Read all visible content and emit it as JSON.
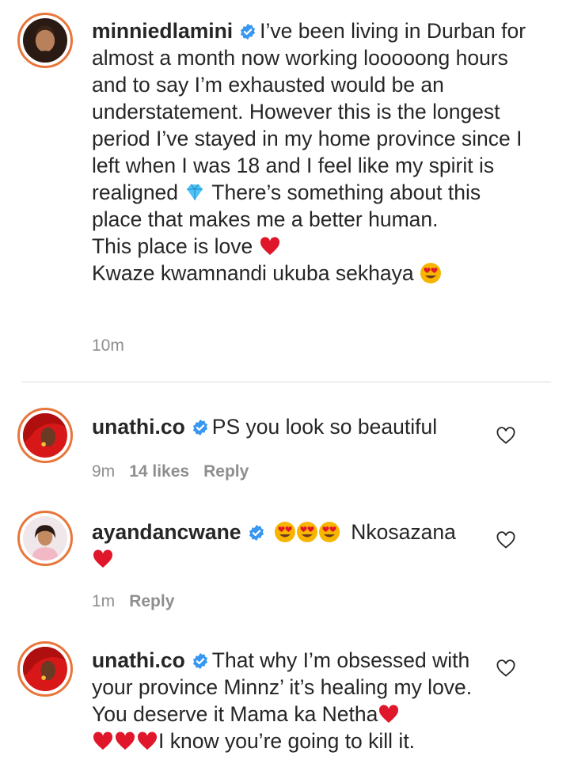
{
  "post": {
    "username": "minniedlamini",
    "caption_1": "I’ve been living in Durban for almost a month now working looooong hours and to say I’m exhausted would be an understatement. However this is the longest period I’ve stayed in my home province since I left when I was 18 and I feel like my spirit is realigned",
    "caption_2": "There’s something about this place that makes me a better human.",
    "caption_3": "This place is love",
    "caption_4": "Kwaze kwamnandi ukuba sekhaya",
    "time": "10m"
  },
  "comments": [
    {
      "username": "unathi.co",
      "text": "PS you look so beautiful",
      "time": "9m",
      "likes": "14 likes",
      "reply": "Reply"
    },
    {
      "username": "ayandancwane",
      "text": "Nkosazana",
      "time": "1m",
      "reply": "Reply"
    },
    {
      "username": "unathi.co",
      "text_1": "That why I’m obsessed with your province Minnz’ it’s healing my love. You deserve it Mama ka Netha",
      "text_2": "I know you’re going to kill it."
    }
  ],
  "colors": {
    "text": "#262626",
    "meta": "#8e8e8e",
    "verified": "#3897f0",
    "avatar_ring": "#e8763a",
    "heart_emoji": "#e0162b",
    "diamond_emoji": "#4fc3f7",
    "smile_emoji": "#f7b500"
  },
  "icons": [
    "verified-badge-icon",
    "diamond-emoji-icon",
    "red-heart-emoji-icon",
    "heart-eyes-emoji-icon",
    "like-heart-outline-icon"
  ]
}
